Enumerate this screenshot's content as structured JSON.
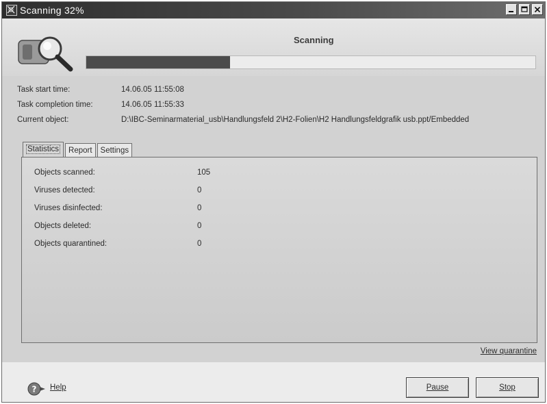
{
  "window": {
    "title": "Scanning 32%"
  },
  "header": {
    "status_title": "Scanning",
    "progress": 0.32
  },
  "task_info": [
    {
      "label": "Task start time:",
      "value": "14.06.05 11:55:08"
    },
    {
      "label": "Task completion time:",
      "value": "14.06.05 11:55:33"
    },
    {
      "label": "Current object:",
      "value": "D:\\IBC-Seminarmaterial_usb\\Handlungsfeld 2\\H2-Folien\\H2 Handlungsfeldgrafik usb.ppt/Embedded"
    }
  ],
  "tabs": [
    {
      "label": "Statistics",
      "active": true
    },
    {
      "label": "Report",
      "active": false
    },
    {
      "label": "Settings",
      "active": false
    }
  ],
  "statistics": [
    {
      "label": "Objects scanned:",
      "value": "105"
    },
    {
      "label": "Viruses detected:",
      "value": "0"
    },
    {
      "label": "Viruses disinfected:",
      "value": "0"
    },
    {
      "label": "Objects deleted:",
      "value": "0"
    },
    {
      "label": "Objects quarantined:",
      "value": "0"
    }
  ],
  "links": {
    "view_quarantine": "View quarantine",
    "help": "Help"
  },
  "buttons": {
    "pause": "Pause",
    "stop": "Stop"
  },
  "icons": {
    "window": "scanner-icon",
    "header": "magnifier-scan-icon",
    "help": "help-icon"
  },
  "colors": {
    "progress_fill": "#4b4b4b",
    "titlebar": "#2e2e2e"
  }
}
